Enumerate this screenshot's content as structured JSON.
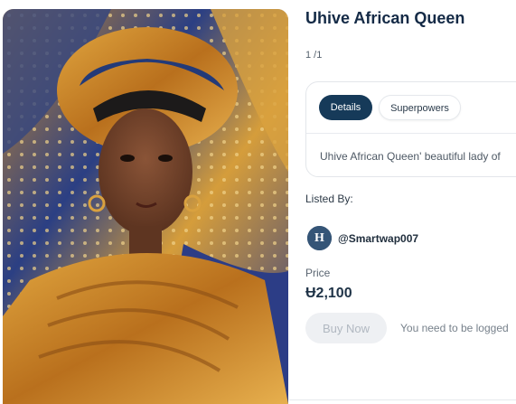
{
  "image": {
    "subject": "portrait"
  },
  "nft": {
    "title": "Uhive African Queen",
    "pager": "1 /1"
  },
  "tabs": [
    {
      "label": "Details",
      "active": true
    },
    {
      "label": "Superpowers",
      "active": false
    }
  ],
  "details": {
    "description": "Uhive African Queen' beautiful lady of"
  },
  "listed_by": {
    "label": "Listed By:",
    "username": "@Smartwap007",
    "avatar_text": "H"
  },
  "price": {
    "label": "Price",
    "value": "Ʉ2,100"
  },
  "actions": {
    "buy_label": "Buy Now",
    "login_note": "You need to be logged"
  },
  "colors": {
    "accent_dark": "#163a59",
    "title": "#142a46",
    "disabled_button_bg": "#eef0f3"
  }
}
